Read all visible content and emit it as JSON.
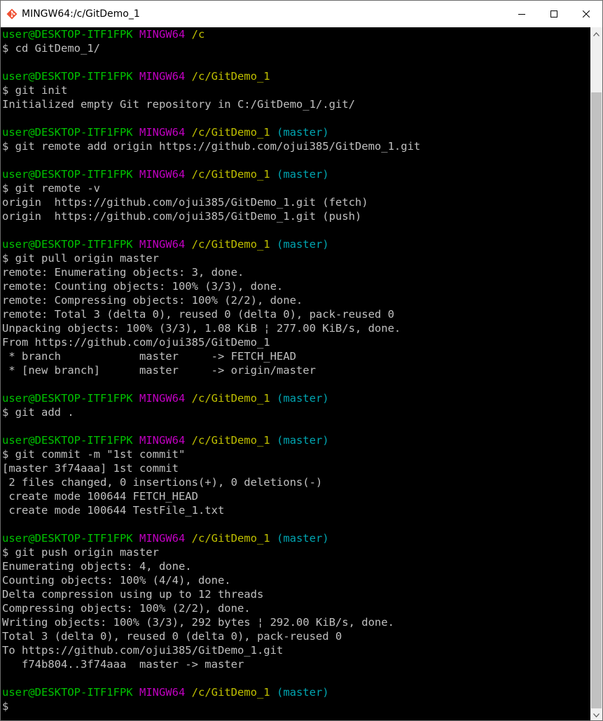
{
  "window": {
    "title": "MINGW64:/c/GitDemo_1"
  },
  "icons": {
    "app": "git-bash-diamond-icon",
    "minimize": "minimize-icon",
    "maximize": "maximize-icon",
    "close": "close-icon",
    "scroll_up": "chevron-up-icon",
    "scroll_down": "chevron-down-icon"
  },
  "colors": {
    "user": "#00c200",
    "host": "#c000c0",
    "path": "#c0c000",
    "branch": "#00a6b2",
    "text": "#c0c0c0",
    "background": "#000000"
  },
  "scrollbar": {
    "position_fraction": 0.1
  },
  "terminal": {
    "lines": [
      {
        "type": "prompt",
        "user": "user@DESKTOP-ITF1FPK",
        "host": "MINGW64",
        "path": "/c",
        "branch": ""
      },
      {
        "type": "text",
        "text": "$ cd GitDemo_1/"
      },
      {
        "type": "text",
        "text": ""
      },
      {
        "type": "prompt",
        "user": "user@DESKTOP-ITF1FPK",
        "host": "MINGW64",
        "path": "/c/GitDemo_1",
        "branch": ""
      },
      {
        "type": "text",
        "text": "$ git init"
      },
      {
        "type": "text",
        "text": "Initialized empty Git repository in C:/GitDemo_1/.git/"
      },
      {
        "type": "text",
        "text": ""
      },
      {
        "type": "prompt",
        "user": "user@DESKTOP-ITF1FPK",
        "host": "MINGW64",
        "path": "/c/GitDemo_1",
        "branch": "(master)"
      },
      {
        "type": "text",
        "text": "$ git remote add origin https://github.com/ojui385/GitDemo_1.git"
      },
      {
        "type": "text",
        "text": ""
      },
      {
        "type": "prompt",
        "user": "user@DESKTOP-ITF1FPK",
        "host": "MINGW64",
        "path": "/c/GitDemo_1",
        "branch": "(master)"
      },
      {
        "type": "text",
        "text": "$ git remote -v"
      },
      {
        "type": "text",
        "text": "origin  https://github.com/ojui385/GitDemo_1.git (fetch)"
      },
      {
        "type": "text",
        "text": "origin  https://github.com/ojui385/GitDemo_1.git (push)"
      },
      {
        "type": "text",
        "text": ""
      },
      {
        "type": "prompt",
        "user": "user@DESKTOP-ITF1FPK",
        "host": "MINGW64",
        "path": "/c/GitDemo_1",
        "branch": "(master)"
      },
      {
        "type": "text",
        "text": "$ git pull origin master"
      },
      {
        "type": "text",
        "text": "remote: Enumerating objects: 3, done."
      },
      {
        "type": "text",
        "text": "remote: Counting objects: 100% (3/3), done."
      },
      {
        "type": "text",
        "text": "remote: Compressing objects: 100% (2/2), done."
      },
      {
        "type": "text",
        "text": "remote: Total 3 (delta 0), reused 0 (delta 0), pack-reused 0"
      },
      {
        "type": "text",
        "text": "Unpacking objects: 100% (3/3), 1.08 KiB ¦ 277.00 KiB/s, done."
      },
      {
        "type": "text",
        "text": "From https://github.com/ojui385/GitDemo_1"
      },
      {
        "type": "text",
        "text": " * branch            master     -> FETCH_HEAD"
      },
      {
        "type": "text",
        "text": " * [new branch]      master     -> origin/master"
      },
      {
        "type": "text",
        "text": ""
      },
      {
        "type": "prompt",
        "user": "user@DESKTOP-ITF1FPK",
        "host": "MINGW64",
        "path": "/c/GitDemo_1",
        "branch": "(master)"
      },
      {
        "type": "text",
        "text": "$ git add ."
      },
      {
        "type": "text",
        "text": ""
      },
      {
        "type": "prompt",
        "user": "user@DESKTOP-ITF1FPK",
        "host": "MINGW64",
        "path": "/c/GitDemo_1",
        "branch": "(master)"
      },
      {
        "type": "text",
        "text": "$ git commit -m \"1st commit\""
      },
      {
        "type": "text",
        "text": "[master 3f74aaa] 1st commit"
      },
      {
        "type": "text",
        "text": " 2 files changed, 0 insertions(+), 0 deletions(-)"
      },
      {
        "type": "text",
        "text": " create mode 100644 FETCH_HEAD"
      },
      {
        "type": "text",
        "text": " create mode 100644 TestFile_1.txt"
      },
      {
        "type": "text",
        "text": ""
      },
      {
        "type": "prompt",
        "user": "user@DESKTOP-ITF1FPK",
        "host": "MINGW64",
        "path": "/c/GitDemo_1",
        "branch": "(master)"
      },
      {
        "type": "text",
        "text": "$ git push origin master"
      },
      {
        "type": "text",
        "text": "Enumerating objects: 4, done."
      },
      {
        "type": "text",
        "text": "Counting objects: 100% (4/4), done."
      },
      {
        "type": "text",
        "text": "Delta compression using up to 12 threads"
      },
      {
        "type": "text",
        "text": "Compressing objects: 100% (2/2), done."
      },
      {
        "type": "text",
        "text": "Writing objects: 100% (3/3), 292 bytes ¦ 292.00 KiB/s, done."
      },
      {
        "type": "text",
        "text": "Total 3 (delta 0), reused 0 (delta 0), pack-reused 0"
      },
      {
        "type": "text",
        "text": "To https://github.com/ojui385/GitDemo_1.git"
      },
      {
        "type": "text",
        "text": "   f74b804..3f74aaa  master -> master"
      },
      {
        "type": "text",
        "text": ""
      },
      {
        "type": "prompt",
        "user": "user@DESKTOP-ITF1FPK",
        "host": "MINGW64",
        "path": "/c/GitDemo_1",
        "branch": "(master)"
      },
      {
        "type": "text",
        "text": "$"
      }
    ]
  }
}
